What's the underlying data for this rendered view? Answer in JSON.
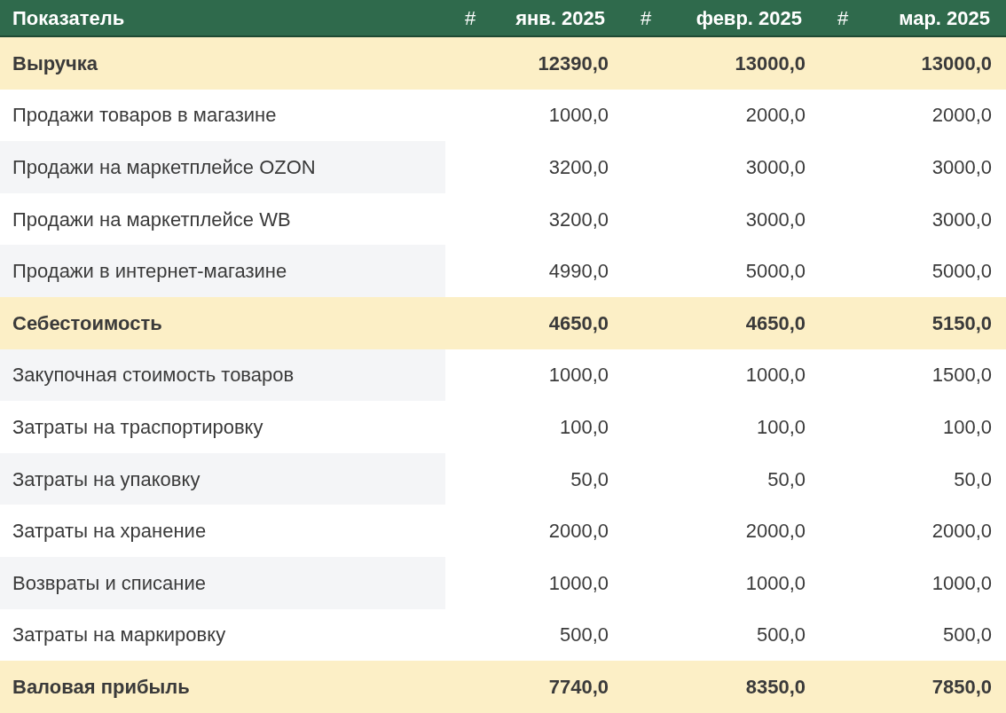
{
  "table": {
    "columns": [
      {
        "label": "Показатель"
      },
      {
        "hash": "#",
        "label": "янв. 2025"
      },
      {
        "hash": "#",
        "label": "февр. 2025"
      },
      {
        "hash": "#",
        "label": "мар. 2025"
      }
    ],
    "rows": [
      {
        "kind": "total",
        "label": "Выручка",
        "values": [
          "12390,0",
          "13000,0",
          "13000,0"
        ]
      },
      {
        "kind": "item",
        "label": "Продажи товаров в магазине",
        "values": [
          "1000,0",
          "2000,0",
          "2000,0"
        ]
      },
      {
        "kind": "item",
        "label": "Продажи на маркетплейсе OZON",
        "values": [
          "3200,0",
          "3000,0",
          "3000,0"
        ]
      },
      {
        "kind": "item",
        "label": "Продажи на маркетплейсе WB",
        "values": [
          "3200,0",
          "3000,0",
          "3000,0"
        ]
      },
      {
        "kind": "item",
        "label": "Продажи в интернет-магазине",
        "values": [
          "4990,0",
          "5000,0",
          "5000,0"
        ]
      },
      {
        "kind": "total",
        "label": "Себестоимость",
        "values": [
          "4650,0",
          "4650,0",
          "5150,0"
        ]
      },
      {
        "kind": "item",
        "label": "Закупочная стоимость товаров",
        "values": [
          "1000,0",
          "1000,0",
          "1500,0"
        ]
      },
      {
        "kind": "item",
        "label": "Затраты на траспортировку",
        "values": [
          "100,0",
          "100,0",
          "100,0"
        ]
      },
      {
        "kind": "item",
        "label": "Затраты на упаковку",
        "values": [
          "50,0",
          "50,0",
          "50,0"
        ]
      },
      {
        "kind": "item",
        "label": "Затраты на хранение",
        "values": [
          "2000,0",
          "2000,0",
          "2000,0"
        ]
      },
      {
        "kind": "item",
        "label": "Возвраты и списание",
        "values": [
          "1000,0",
          "1000,0",
          "1000,0"
        ]
      },
      {
        "kind": "item",
        "label": "Затраты на маркировку",
        "values": [
          "500,0",
          "500,0",
          "500,0"
        ]
      },
      {
        "kind": "total",
        "label": "Валовая прибыль",
        "values": [
          "7740,0",
          "8350,0",
          "7850,0"
        ]
      }
    ]
  }
}
